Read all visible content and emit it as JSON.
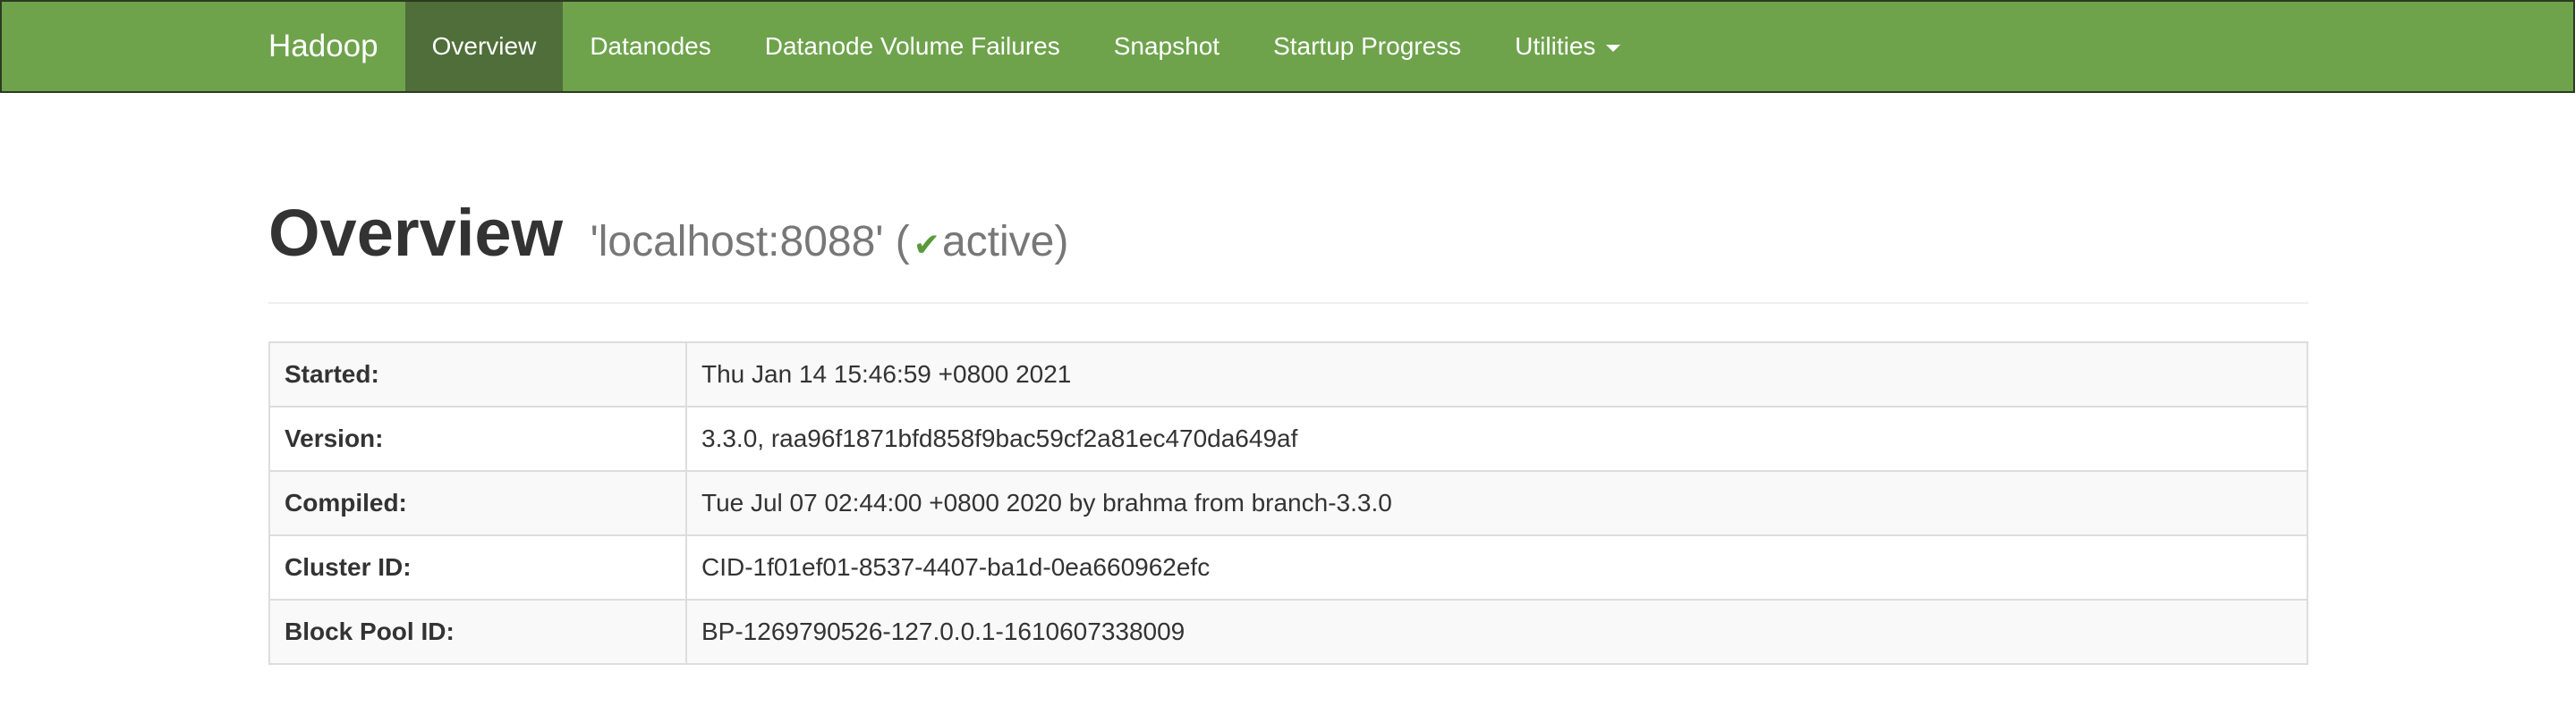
{
  "navbar": {
    "brand": "Hadoop",
    "items": [
      {
        "label": "Overview",
        "active": true
      },
      {
        "label": "Datanodes",
        "active": false
      },
      {
        "label": "Datanode Volume Failures",
        "active": false
      },
      {
        "label": "Snapshot",
        "active": false
      },
      {
        "label": "Startup Progress",
        "active": false
      },
      {
        "label": "Utilities",
        "active": false,
        "dropdown": true
      }
    ],
    "colors": {
      "background": "#6ea34c",
      "active_background": "#4f6e39",
      "text": "#ffffff"
    }
  },
  "header": {
    "title": "Overview",
    "host": "'localhost:8088' (",
    "check_icon": "check-icon",
    "status": "active)",
    "status_color": "#5a9a3a"
  },
  "info": {
    "rows": [
      {
        "label": "Started:",
        "value": "Thu Jan 14 15:46:59 +0800 2021"
      },
      {
        "label": "Version:",
        "value": "3.3.0, raa96f1871bfd858f9bac59cf2a81ec470da649af"
      },
      {
        "label": "Compiled:",
        "value": "Tue Jul 07 02:44:00 +0800 2020 by brahma from branch-3.3.0"
      },
      {
        "label": "Cluster ID:",
        "value": "CID-1f01ef01-8537-4407-ba1d-0ea660962efc"
      },
      {
        "label": "Block Pool ID:",
        "value": "BP-1269790526-127.0.0.1-1610607338009"
      }
    ]
  }
}
